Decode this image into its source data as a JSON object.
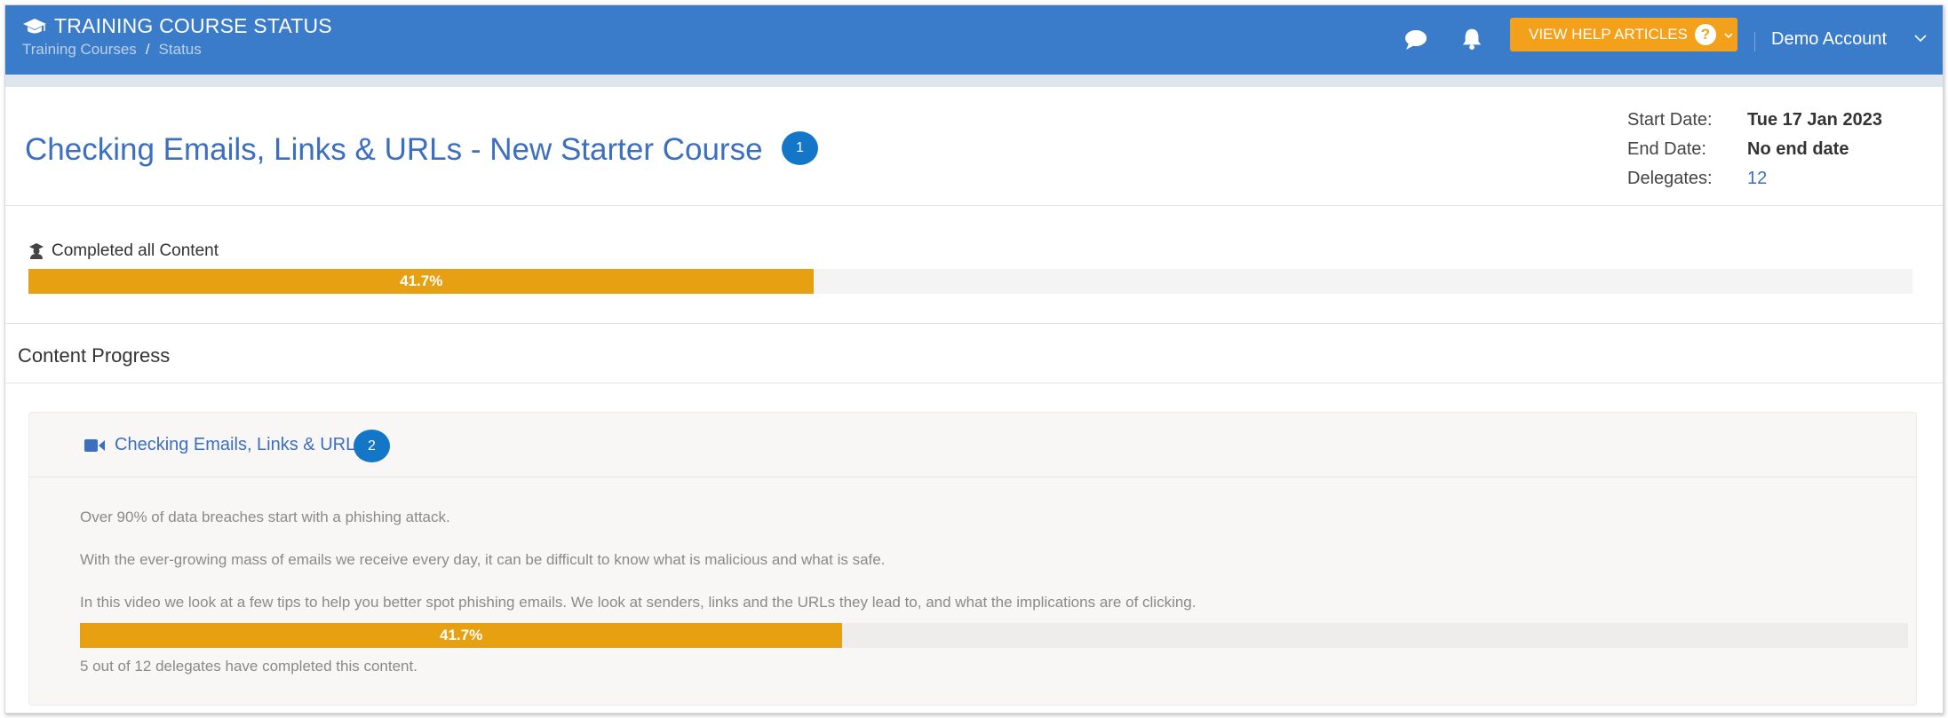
{
  "header": {
    "title": "TRAINING COURSE STATUS",
    "breadcrumb": [
      "Training Courses",
      "Status"
    ],
    "breadcrumb_separator": "/",
    "help_button_label": "VIEW HELP ARTICLES",
    "help_icon_glyph": "?",
    "account_name": "Demo Account",
    "icons": [
      "graduation-cap-icon",
      "chat-icon",
      "bell-icon",
      "question-icon",
      "chevron-down-icon"
    ]
  },
  "course": {
    "title": "Checking Emails, Links & URLs - New Starter Course",
    "badge": "1",
    "meta": [
      {
        "label": "Start Date:",
        "value": "Tue 17 Jan 2023"
      },
      {
        "label": "End Date:",
        "value": "No end date"
      },
      {
        "label": "Delegates:",
        "value": "12"
      }
    ]
  },
  "completed": {
    "label": "Completed all Content",
    "percent_label": "41.7%",
    "percent": 41.7
  },
  "content_progress": {
    "title": "Content Progress",
    "items": [
      {
        "title": "Checking Emails, Links & URLs",
        "badge": "2",
        "paragraphs": [
          "Over 90% of data breaches start with a phishing attack.",
          "With the ever-growing mass of emails we receive every day, it can be difficult to know what is malicious and what is safe.",
          "In this video we look at a few tips to help you better spot phishing emails. We look at senders, links and the URLs they lead to, and what the implications are of clicking."
        ],
        "percent_label": "41.7%",
        "percent": 41.7,
        "summary": "5 out of 12 delegates have completed this content."
      }
    ]
  },
  "colors": {
    "header_bg": "#3a7cc9",
    "accent_blue": "#3c6fc0",
    "badge_blue": "#1476c6",
    "progress_orange": "#e8a013",
    "help_button_orange": "#f3a11a"
  }
}
